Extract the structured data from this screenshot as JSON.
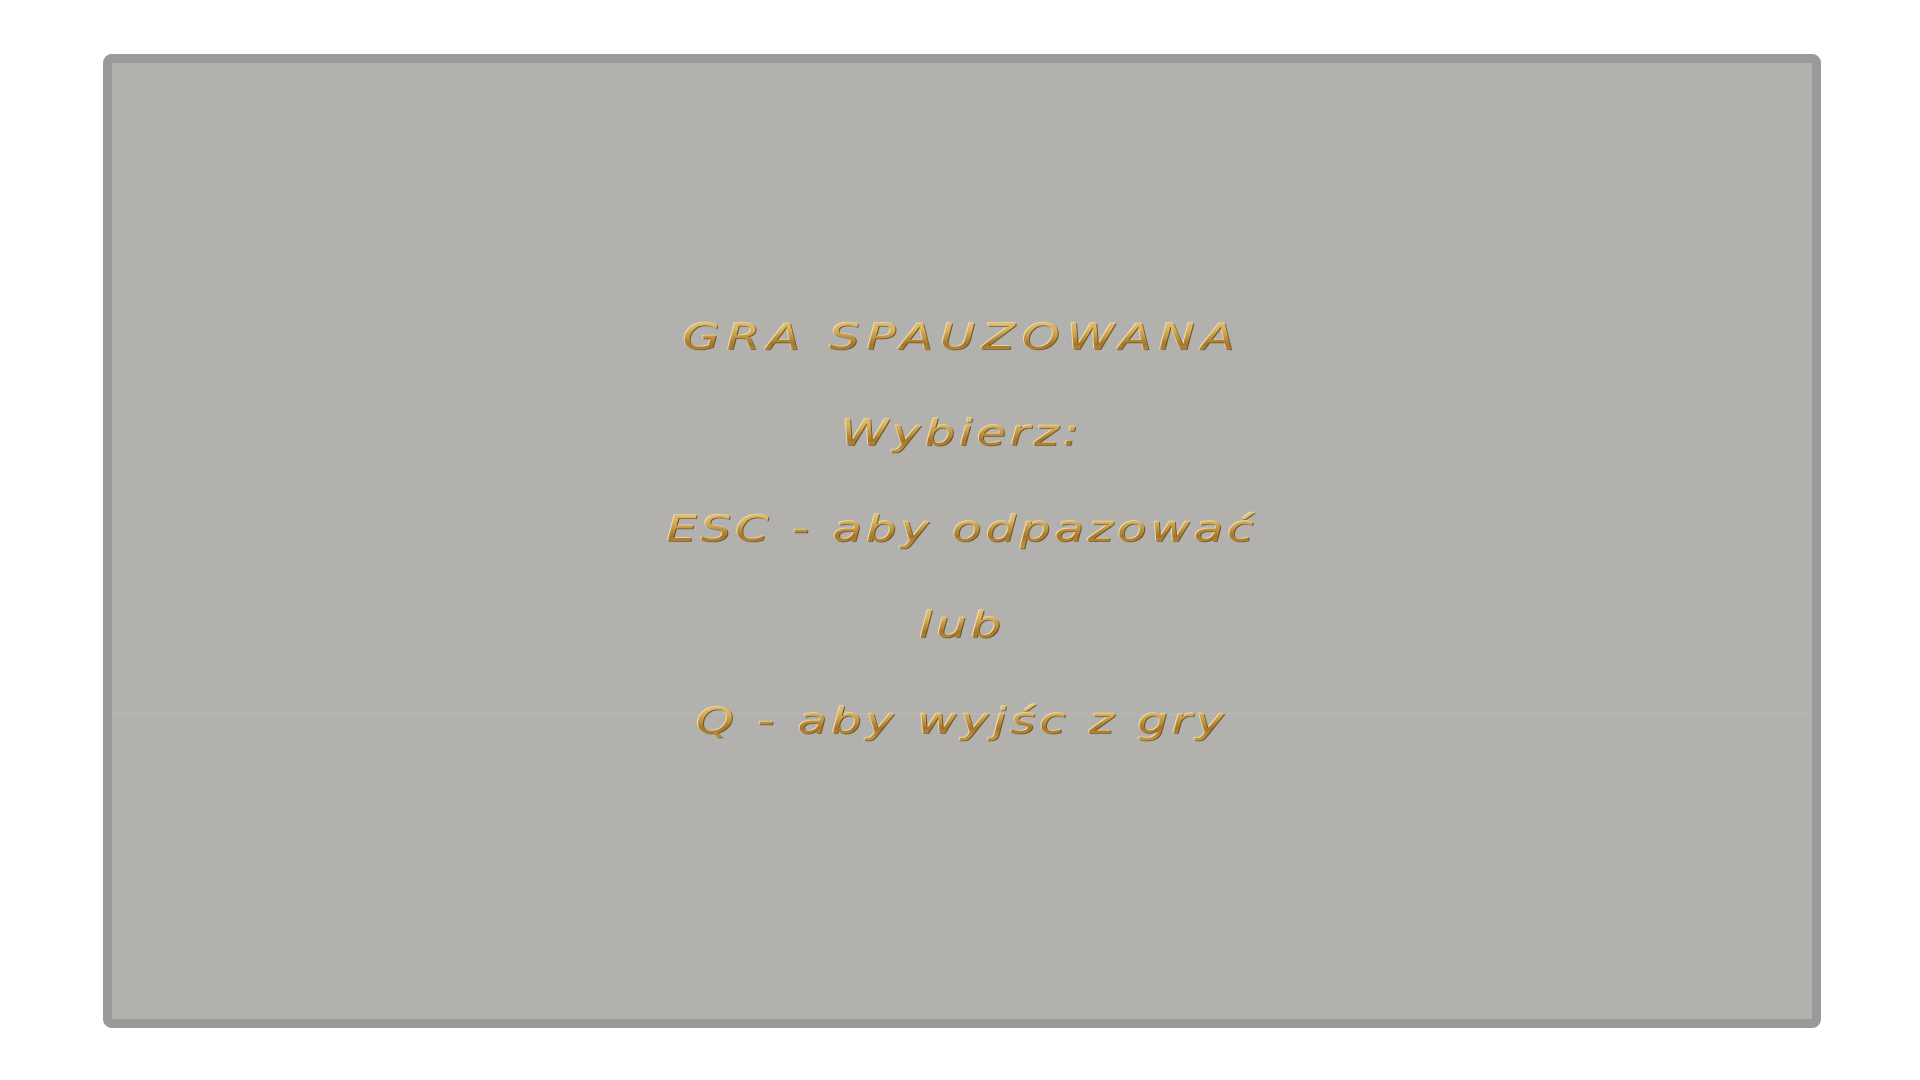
{
  "pause_menu": {
    "title": "GRA SPAUZOWANA",
    "prompt": "Wybierz:",
    "option_resume": "ESC - aby odpazować",
    "separator": "lub",
    "option_quit": "Q - aby wyjśc z gry"
  },
  "colors": {
    "panel_background": "#b2b1ad",
    "panel_border": "#9a9a9a",
    "text_gold": "#c9a24a"
  }
}
